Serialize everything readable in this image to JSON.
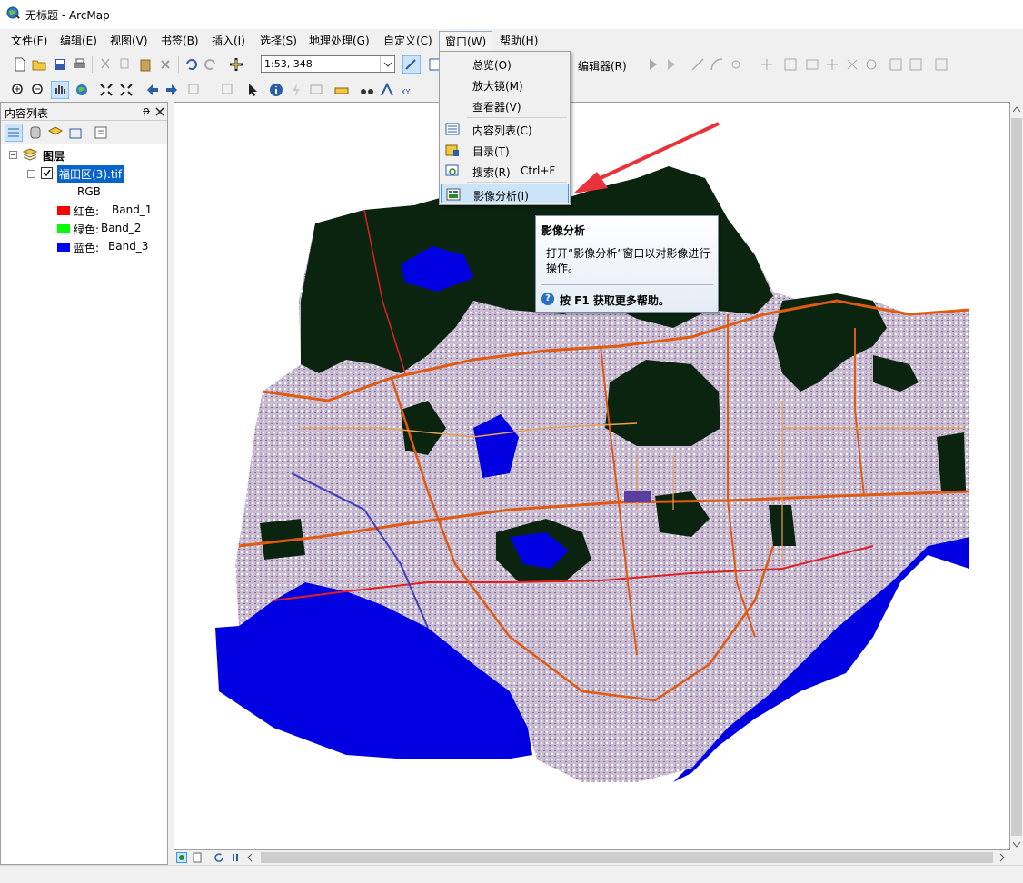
{
  "window": {
    "title": "无标题 - ArcMap"
  },
  "menubar": {
    "items": [
      "文件(F)",
      "编辑(E)",
      "视图(V)",
      "书签(B)",
      "插入(I)",
      "选择(S)",
      "地理处理(G)",
      "自定义(C)",
      "窗口(W)",
      "帮助(H)"
    ]
  },
  "toolbar": {
    "scale": "1:53, 348",
    "editor_label": "编辑器(R)"
  },
  "toc": {
    "title": "内容列表",
    "root": "图层",
    "layer": "福田区(3).tif",
    "rgb": "RGB",
    "bands": [
      {
        "label": "红色:",
        "band": "Band_1",
        "color": "#ff0000"
      },
      {
        "label": "绿色:",
        "band": "Band_2",
        "color": "#00ff00"
      },
      {
        "label": "蓝色:",
        "band": "Band_3",
        "color": "#0000ff"
      }
    ]
  },
  "window_menu": {
    "items": [
      {
        "label": "总览(O)"
      },
      {
        "label": "放大镜(M)"
      },
      {
        "label": "查看器(V)"
      },
      {
        "label": "内容列表(C)"
      },
      {
        "label": "目录(T)"
      },
      {
        "label": "搜索(R)",
        "shortcut": "Ctrl+F"
      },
      {
        "label": "影像分析(I)"
      }
    ]
  },
  "tooltip": {
    "title": "影像分析",
    "body": "打开“影像分析”窗口以对影像进行操作。",
    "help": "按 F1 获取更多帮助。"
  },
  "colors": {
    "water": "#0000e0",
    "forest": "#0b2410",
    "urban": "#c9bcd2",
    "road": "#e05a10",
    "arrow": "#e8333a"
  }
}
